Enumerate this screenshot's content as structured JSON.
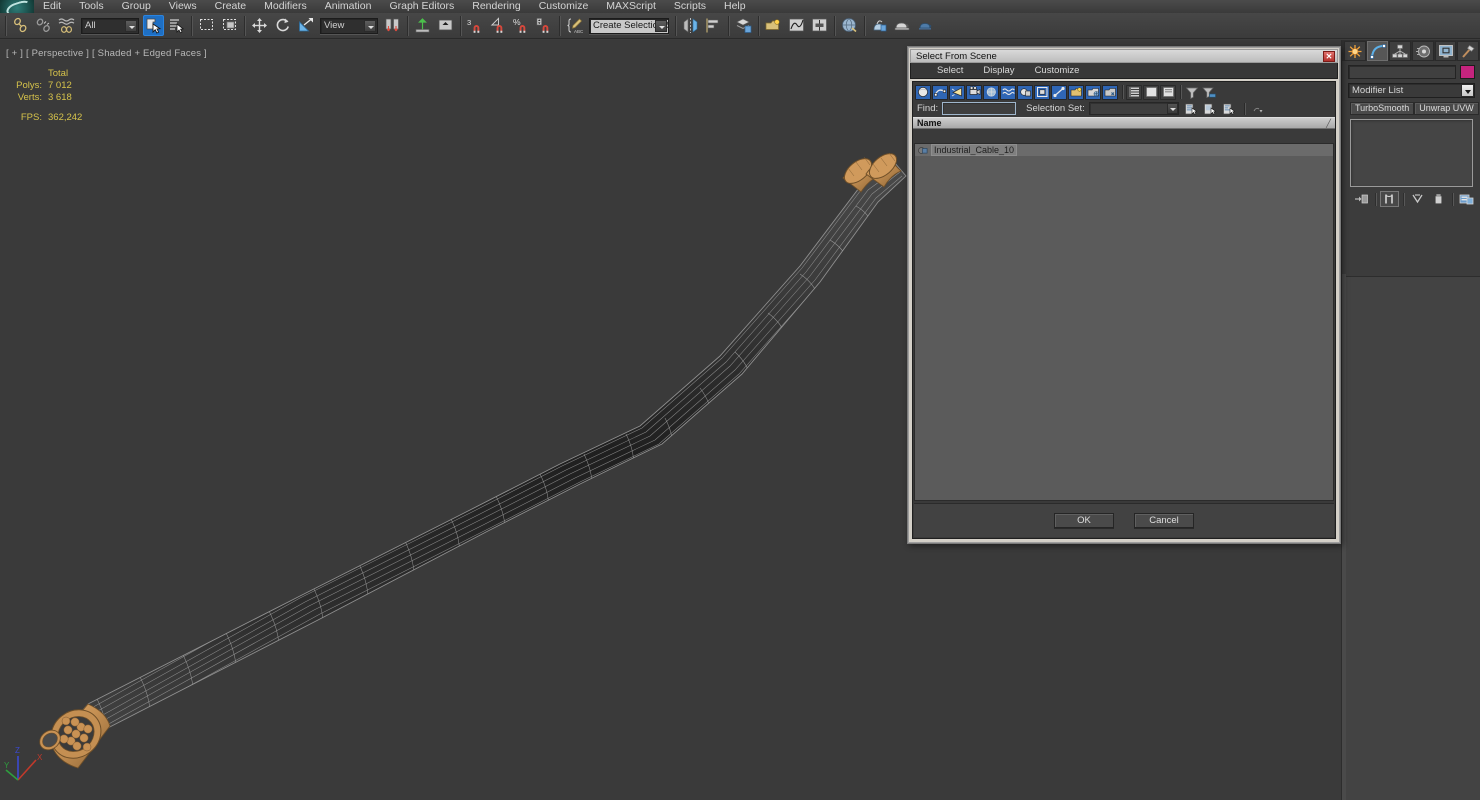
{
  "app": {
    "logo": "3ds-max-logo",
    "menu": [
      "Edit",
      "Tools",
      "Group",
      "Views",
      "Create",
      "Modifiers",
      "Animation",
      "Graph Editors",
      "Rendering",
      "Customize",
      "MAXScript",
      "Scripts",
      "Help"
    ]
  },
  "toolbar": {
    "selection_filter": "All",
    "reference_coord": "View",
    "named_selection_set": "Create Selection Se",
    "buttons": [
      {
        "name": "select-link-button",
        "icon": "link-icon"
      },
      {
        "name": "unlink-selection-button",
        "icon": "unlink-icon"
      },
      {
        "name": "bind-to-space-warp-button",
        "icon": "space-warp-icon"
      },
      {
        "name": "select-object-button",
        "icon": "select-arrow-icon",
        "active": true
      },
      {
        "name": "select-by-name-button",
        "icon": "select-by-name-icon"
      },
      {
        "name": "rectangular-selection-region-button",
        "icon": "rectangle-region-icon"
      },
      {
        "name": "window-crossing-button",
        "icon": "window-crossing-icon"
      },
      {
        "name": "select-and-move-button",
        "icon": "move-icon"
      },
      {
        "name": "select-and-rotate-button",
        "icon": "rotate-icon"
      },
      {
        "name": "select-and-scale-button",
        "icon": "scale-icon"
      },
      {
        "name": "use-pivot-point-center-button",
        "icon": "pivot-center-icon"
      },
      {
        "name": "select-and-manipulate-button",
        "icon": "manipulate-icon"
      },
      {
        "name": "snap-toggle-button",
        "icon": "snaps-3-icon"
      },
      {
        "name": "angle-snap-toggle-button",
        "icon": "angle-snap-icon"
      },
      {
        "name": "percent-snap-toggle-button",
        "icon": "percent-snap-icon"
      },
      {
        "name": "spinner-snap-toggle-button",
        "icon": "spinner-snap-icon"
      },
      {
        "name": "edit-named-selection-sets-button",
        "icon": "named-sets-icon"
      },
      {
        "name": "mirror-button",
        "icon": "mirror-icon"
      },
      {
        "name": "align-button",
        "icon": "align-icon"
      },
      {
        "name": "layer-manager-button",
        "icon": "layers-icon"
      },
      {
        "name": "toggle-scene-explorer-button",
        "icon": "scene-explorer-icon"
      },
      {
        "name": "curve-editor-button",
        "icon": "curve-editor-icon"
      },
      {
        "name": "schematic-view-button",
        "icon": "schematic-view-icon"
      },
      {
        "name": "material-editor-button",
        "icon": "material-editor-icon"
      },
      {
        "name": "render-setup-button",
        "icon": "render-setup-icon"
      },
      {
        "name": "rendered-frame-window-button",
        "icon": "render-frame-icon"
      },
      {
        "name": "render-production-button",
        "icon": "render-teapot-icon"
      }
    ]
  },
  "viewport": {
    "label": "[ + ] [ Perspective ] [ Shaded + Edged Faces ]",
    "stats": {
      "header": "Total",
      "rows": [
        {
          "label": "Polys:",
          "value": "7 012"
        },
        {
          "label": "Verts:",
          "value": "3 618"
        }
      ],
      "fps_label": "FPS:",
      "fps_value": "362,242"
    },
    "axis": {
      "x": "X",
      "y": "Y",
      "z": "Z"
    },
    "object_color_cap": "#c99254",
    "object_color_body": "#2f2f2f",
    "wireframe_color": "#b9b9b9",
    "background_color": "#3a3a3a"
  },
  "command_panel": {
    "tabs": [
      {
        "name": "create-tab",
        "icon": "create-star-icon",
        "active": false
      },
      {
        "name": "modify-tab",
        "icon": "modify-arc-icon",
        "active": true
      },
      {
        "name": "hierarchy-tab",
        "icon": "hierarchy-icon",
        "active": false
      },
      {
        "name": "motion-tab",
        "icon": "motion-wheel-icon",
        "active": false
      },
      {
        "name": "display-tab",
        "icon": "display-monitor-icon",
        "active": false
      },
      {
        "name": "utilities-tab",
        "icon": "utilities-hammer-icon",
        "active": false
      }
    ],
    "object_name": "",
    "object_color": "#c5247e",
    "modifier_list_label": "Modifier List",
    "modifier_buttons": [
      "TurboSmooth",
      "Unwrap UVW"
    ],
    "stack_tools": [
      {
        "name": "pin-stack-button",
        "icon": "pin-stack-icon"
      },
      {
        "name": "show-end-result-button",
        "icon": "show-end-result-icon"
      },
      {
        "name": "make-unique-button",
        "icon": "make-unique-icon"
      },
      {
        "name": "remove-modifier-button",
        "icon": "trash-icon"
      },
      {
        "name": "configure-modifier-sets-button",
        "icon": "configure-sets-icon"
      }
    ]
  },
  "dialog": {
    "title": "Select From Scene",
    "close_label": "✕",
    "menu": [
      "Select",
      "Display",
      "Customize"
    ],
    "toolbar_buttons": [
      {
        "name": "display-geometry-button",
        "icon": "geometry-sphere-icon",
        "on": true
      },
      {
        "name": "display-shapes-button",
        "icon": "shapes-icon",
        "on": true
      },
      {
        "name": "display-lights-button",
        "icon": "light-icon",
        "on": true
      },
      {
        "name": "display-cameras-button",
        "icon": "camera-icon",
        "on": true
      },
      {
        "name": "display-helpers-button",
        "icon": "helper-icon",
        "on": true
      },
      {
        "name": "display-space-warps-button",
        "icon": "space-warp-wave-icon",
        "on": true
      },
      {
        "name": "display-groups-button",
        "icon": "group-icon",
        "on": true
      },
      {
        "name": "display-xrefs-button",
        "icon": "xref-icon",
        "on": true
      },
      {
        "name": "display-bones-button",
        "icon": "bone-icon",
        "on": true
      },
      {
        "name": "display-containers-button",
        "icon": "container-icon",
        "on": true
      },
      {
        "name": "display-frozen-button",
        "icon": "frozen-icon",
        "on": true
      },
      {
        "name": "display-hidden-button",
        "icon": "hidden-icon",
        "on": true
      },
      {
        "name": "expand-all-button",
        "icon": "expand-all-icon",
        "on": false
      },
      {
        "name": "collapse-all-button",
        "icon": "collapse-all-icon",
        "on": false
      },
      {
        "name": "expand-selected-button",
        "icon": "expand-selected-icon",
        "on": false
      },
      {
        "name": "filter-button",
        "icon": "funnel-icon",
        "on": false
      },
      {
        "name": "advanced-filter-button",
        "icon": "advanced-funnel-icon",
        "on": false
      }
    ],
    "find_label": "Find:",
    "find_value": "",
    "find_placeholder": "",
    "selection_set_label": "Selection Set:",
    "selection_set_value": "",
    "selection_set_buttons": [
      {
        "name": "select-children-button",
        "icon": "select-children-icon"
      },
      {
        "name": "select-influences-button",
        "icon": "select-influences-icon"
      },
      {
        "name": "select-dependents-button",
        "icon": "select-dependents-icon"
      }
    ],
    "column_header": "Name",
    "sort_indicator": "╱",
    "rows": [
      {
        "name": "Industrial_Cable_10",
        "icon": "geometry-node-icon",
        "selected": true
      }
    ],
    "ok_label": "OK",
    "cancel_label": "Cancel"
  }
}
